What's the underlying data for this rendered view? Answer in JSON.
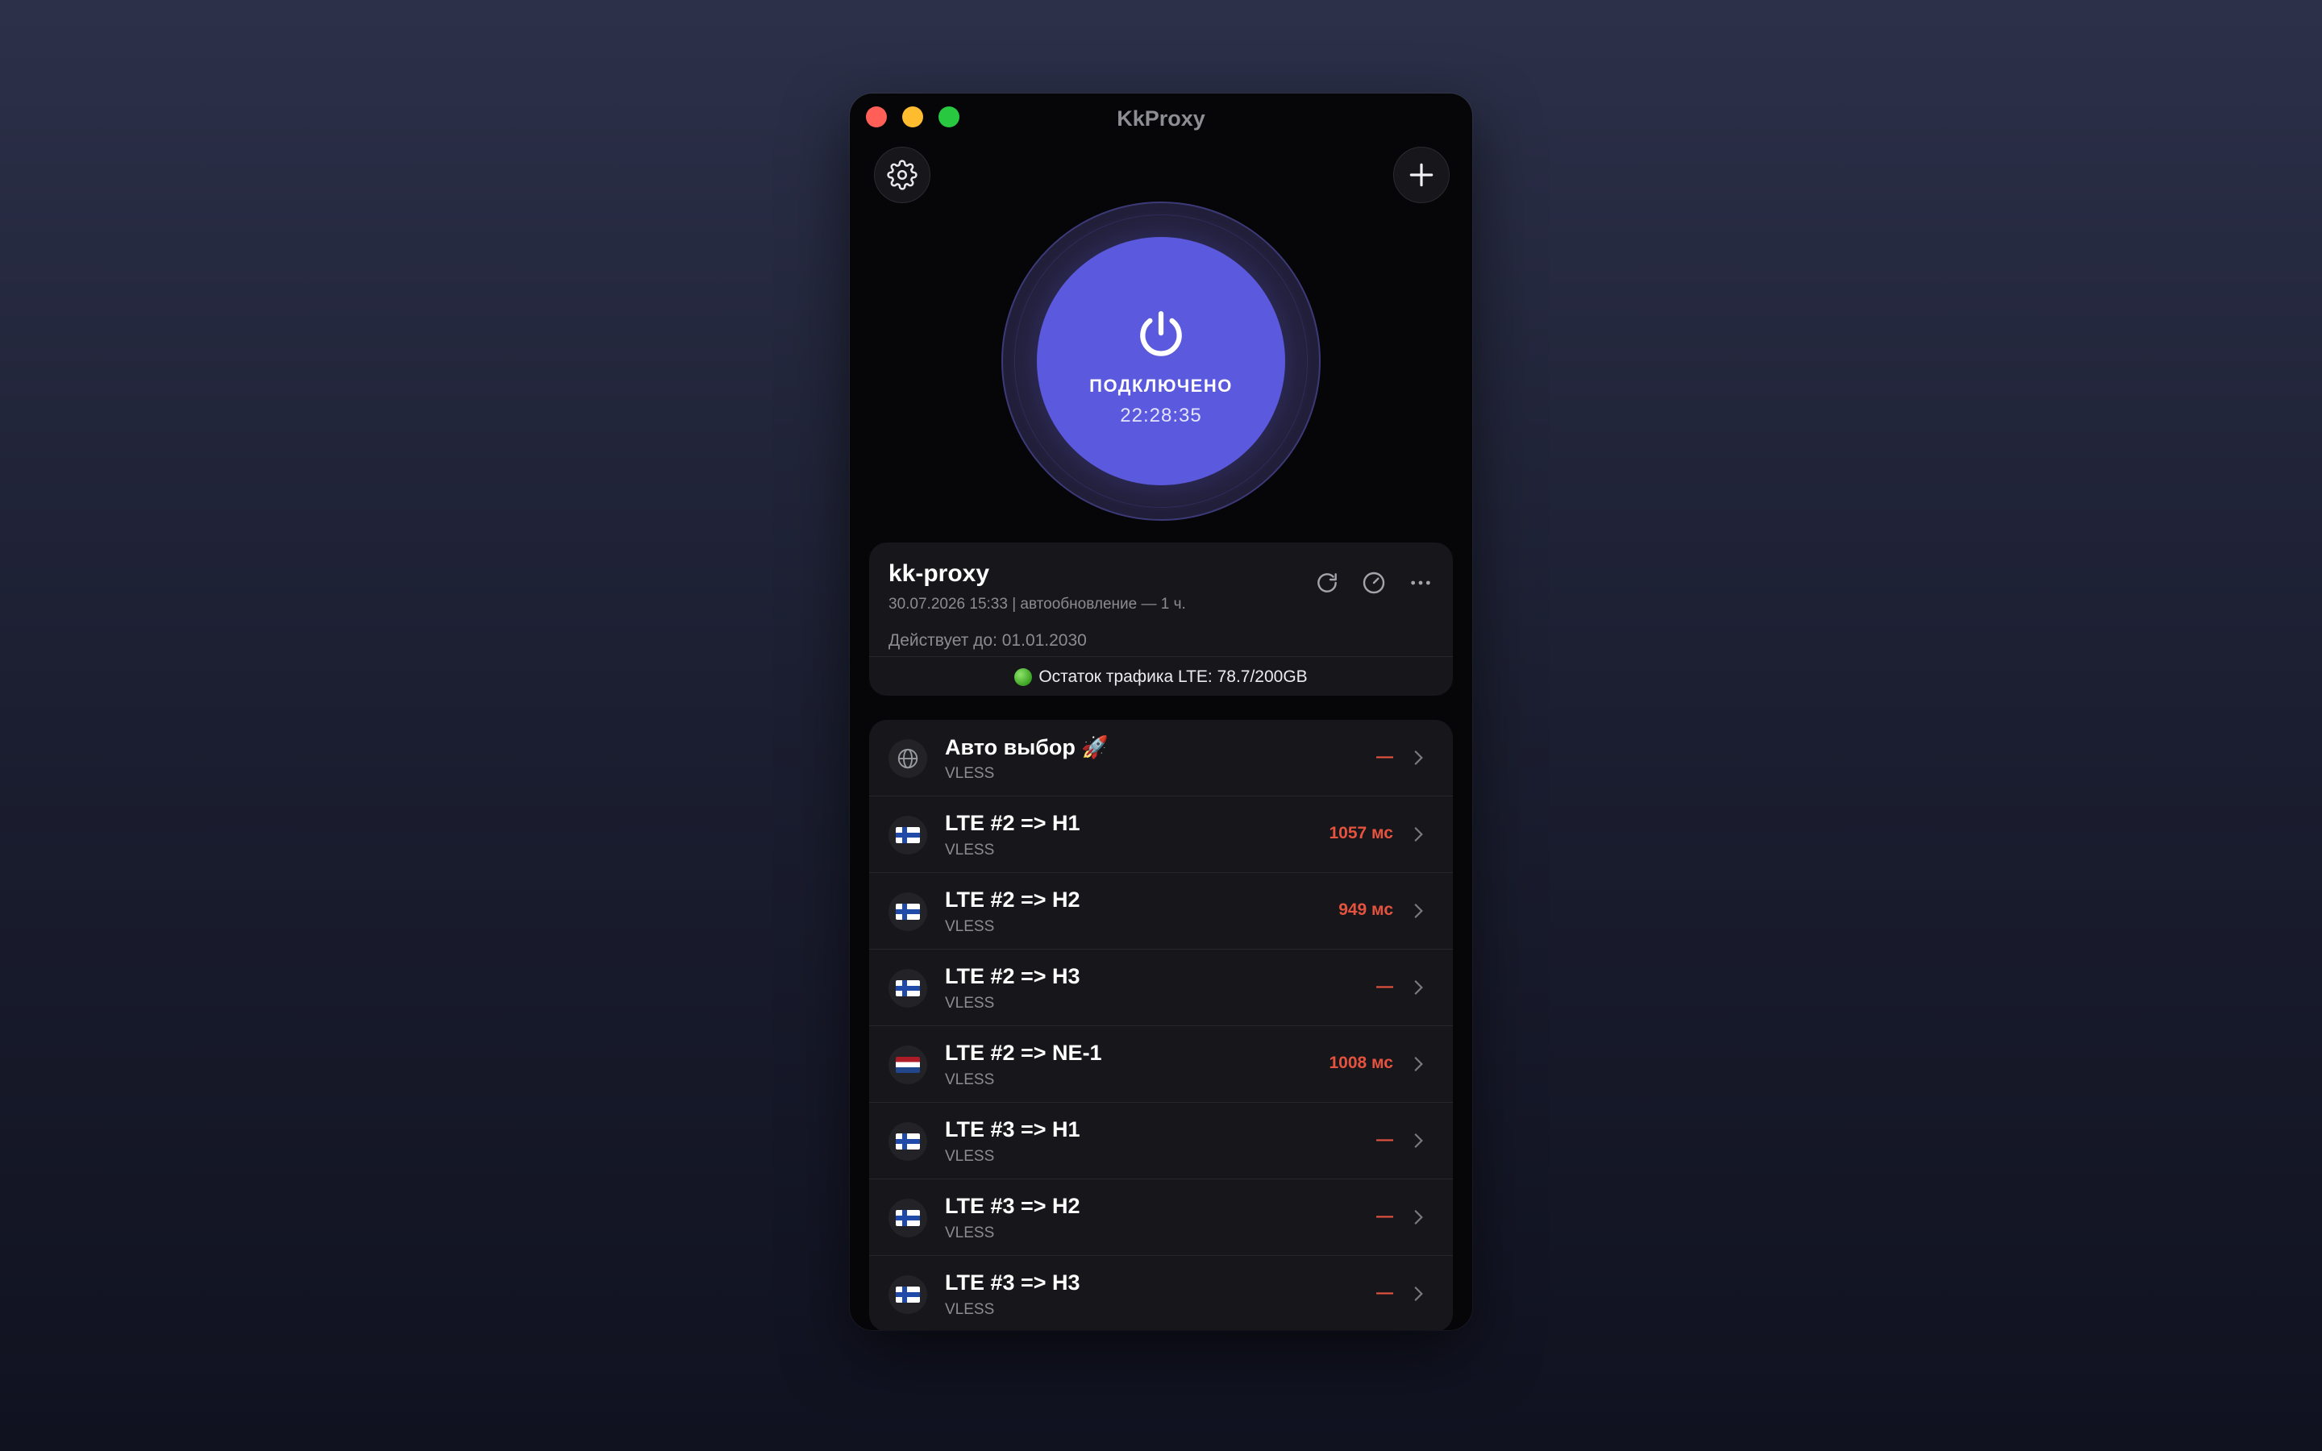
{
  "window": {
    "title": "KkProxy"
  },
  "toolbar": {
    "settings_icon": "gear-icon",
    "add_icon": "plus-icon"
  },
  "connection": {
    "status": "ПОДКЛЮЧЕНО",
    "timer": "22:28:35",
    "accent_color": "#5b59dd"
  },
  "subscription": {
    "name": "kk-proxy",
    "meta": "30.07.2026 15:33 | автообновление — 1 ч.",
    "valid_until": "Действует до: 01.01.2030",
    "traffic": "Остаток трафика LTE: 78.7/200GB",
    "actions": [
      "refresh-icon",
      "speed-test-icon",
      "more-icon"
    ]
  },
  "servers": [
    {
      "name": "Авто выбор 🚀",
      "protocol": "VLESS",
      "ping": "—",
      "icon": "globe-icon"
    },
    {
      "name": "LTE #2 => H1",
      "protocol": "VLESS",
      "ping": "1057 мс",
      "icon": "flag-fi"
    },
    {
      "name": "LTE #2 => H2",
      "protocol": "VLESS",
      "ping": "949 мс",
      "icon": "flag-fi"
    },
    {
      "name": "LTE #2 => H3",
      "protocol": "VLESS",
      "ping": "—",
      "icon": "flag-fi"
    },
    {
      "name": "LTE #2 => NE-1",
      "protocol": "VLESS",
      "ping": "1008 мс",
      "icon": "flag-nl"
    },
    {
      "name": "LTE #3 => H1",
      "protocol": "VLESS",
      "ping": "—",
      "icon": "flag-fi"
    },
    {
      "name": "LTE #3 => H2",
      "protocol": "VLESS",
      "ping": "—",
      "icon": "flag-fi"
    },
    {
      "name": "LTE #3 => H3",
      "protocol": "VLESS",
      "ping": "—",
      "icon": "flag-fi"
    }
  ],
  "colors": {
    "ping": "#e5533f",
    "background": "#060608",
    "card": "#17171b"
  }
}
